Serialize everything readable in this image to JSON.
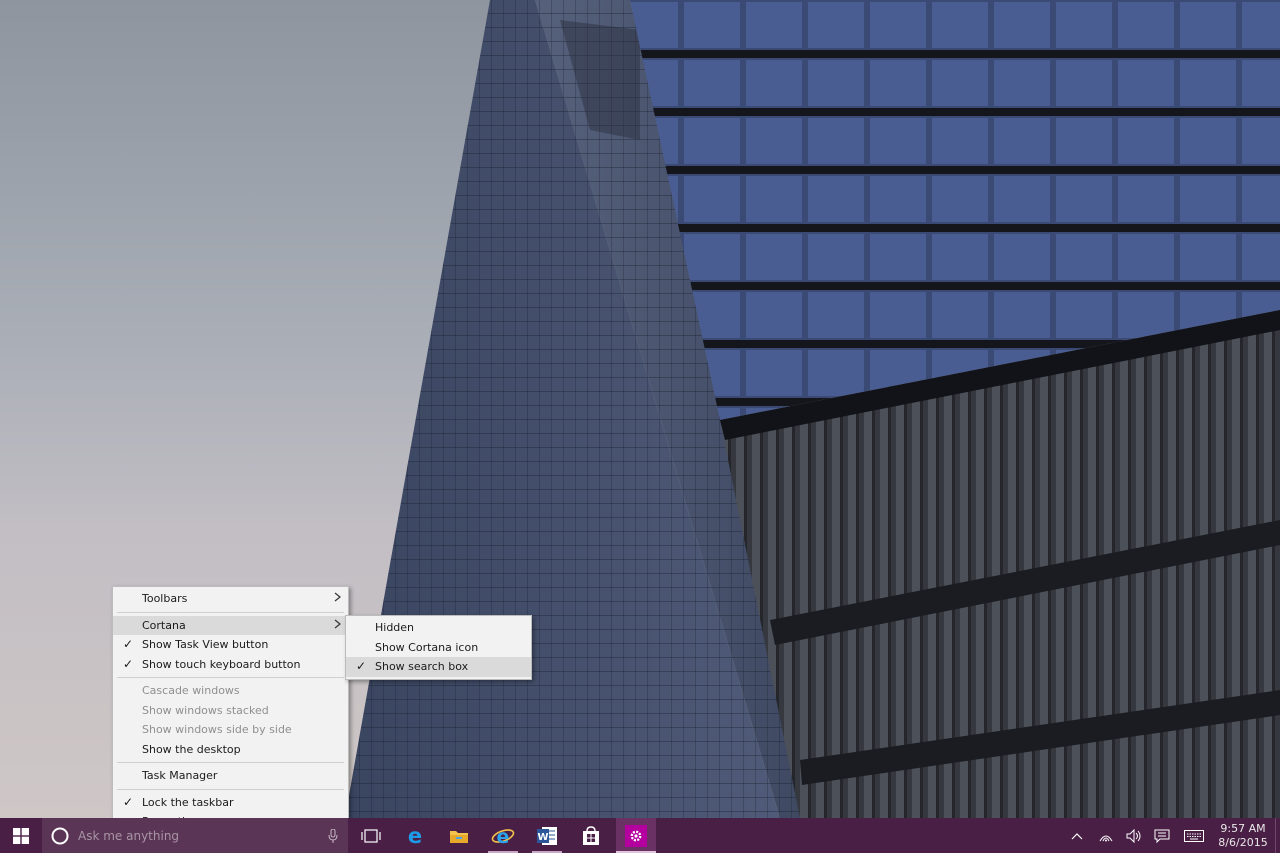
{
  "taskbar": {
    "search_placeholder": "Ask me anything",
    "clock_time": "9:57 AM",
    "clock_date": "8/6/2015",
    "color": "#4a1f46"
  },
  "context_menu": {
    "toolbars": "Toolbars",
    "cortana": "Cortana",
    "show_task_view": "Show Task View button",
    "show_touch_keyboard": "Show touch keyboard button",
    "cascade": "Cascade windows",
    "stacked": "Show windows stacked",
    "side_by_side": "Show windows side by side",
    "show_desktop": "Show the desktop",
    "task_manager": "Task Manager",
    "lock_taskbar": "Lock the taskbar",
    "properties": "Properties"
  },
  "cortana_submenu": {
    "hidden": "Hidden",
    "show_icon": "Show Cortana icon",
    "show_search_box": "Show search box"
  },
  "icons": [
    "windows-logo-icon",
    "cortana-icon",
    "microphone-icon",
    "task-view-icon",
    "edge-icon",
    "file-explorer-icon",
    "internet-explorer-icon",
    "word-icon",
    "store-icon",
    "settings-icon",
    "chevron-up-icon",
    "wifi-icon",
    "volume-icon",
    "action-center-icon",
    "keyboard-icon"
  ]
}
